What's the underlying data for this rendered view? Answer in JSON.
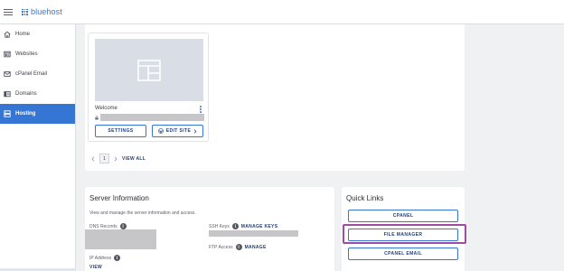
{
  "brand": {
    "name": "bluehost",
    "accent": "#3575d3"
  },
  "nav": [
    {
      "label": "Home",
      "icon": "home-icon"
    },
    {
      "label": "Websites",
      "icon": "websites-icon"
    },
    {
      "label": "cPanel Email",
      "icon": "mail-icon"
    },
    {
      "label": "Domains",
      "icon": "domains-icon"
    },
    {
      "label": "Hosting",
      "icon": "hosting-icon",
      "active": true
    }
  ],
  "site_card": {
    "name": "Welcome",
    "settings_label": "SETTINGS",
    "edit_site_label": "EDIT SITE",
    "current_page": "1",
    "view_all_label": "VIEW ALL"
  },
  "server_info": {
    "title": "Server Information",
    "subtitle": "View and manage the server information and access.",
    "dns_label": "DNS Records",
    "ssh_label": "SSH Keys",
    "ssh_action": "MANAGE KEYS",
    "ftp_label": "FTP Access",
    "ftp_action": "MANAGE",
    "ip_label": "IP Address",
    "ip_action": "VIEW"
  },
  "quick_links": {
    "title": "Quick Links",
    "items": [
      "CPANEL",
      "FILE MANAGER",
      "CPANEL EMAIL"
    ],
    "highlight_color": "#a24aa3"
  }
}
